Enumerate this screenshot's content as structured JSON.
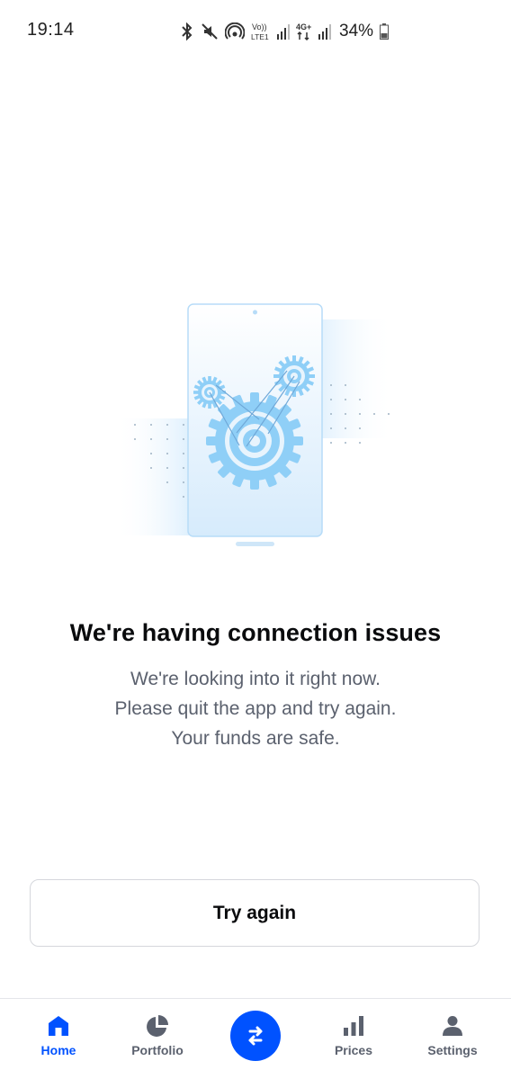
{
  "status_bar": {
    "time": "19:14",
    "battery_percent": "34%",
    "network_labels": {
      "volte": "Vo)) LTE1",
      "network_type": "4G+"
    },
    "icons": [
      "bluetooth-icon",
      "mute-icon",
      "hotspot-icon",
      "volte-icon",
      "signal-icon",
      "4g-icon",
      "signal-icon",
      "battery-icon"
    ]
  },
  "error": {
    "title": "We're having connection issues",
    "lines": [
      "We're looking into it right now.",
      "Please quit the app and try again.",
      "Your funds are safe."
    ]
  },
  "actions": {
    "try_again_label": "Try again"
  },
  "bottom_nav": {
    "items": [
      {
        "label": "Home",
        "icon": "home-icon",
        "active": true
      },
      {
        "label": "Portfolio",
        "icon": "pie-chart-icon",
        "active": false
      },
      {
        "label": "",
        "icon": "swap-arrows-icon",
        "active": false
      },
      {
        "label": "Prices",
        "icon": "bar-chart-icon",
        "active": false
      },
      {
        "label": "Settings",
        "icon": "person-icon",
        "active": false
      }
    ]
  },
  "colors": {
    "brand_blue": "#0052ff",
    "text_primary": "#0a0b0d",
    "text_secondary": "#5b616e",
    "illustration_blue": "#8fcff7"
  }
}
